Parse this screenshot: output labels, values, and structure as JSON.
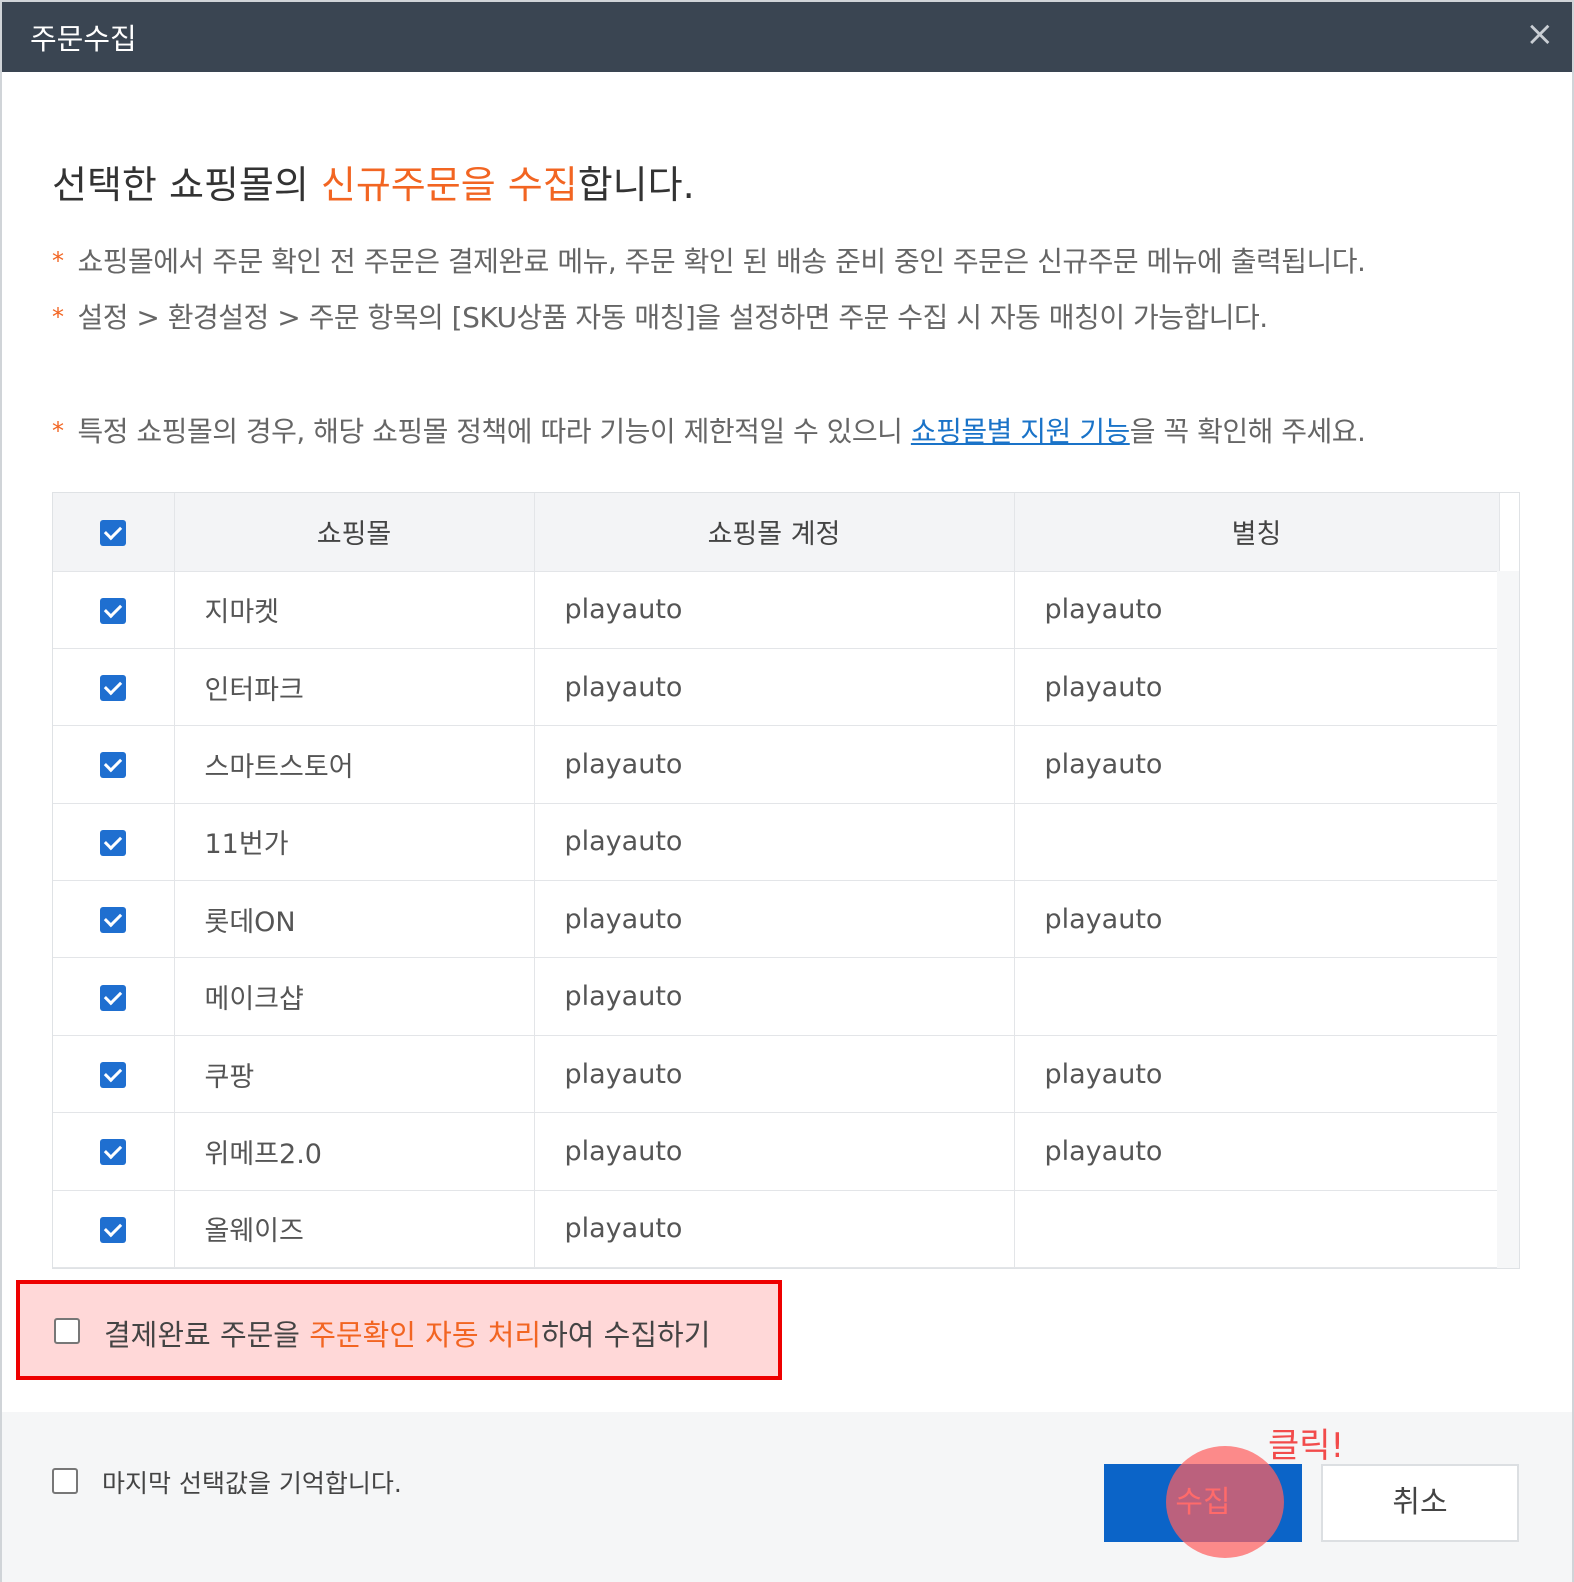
{
  "dialog": {
    "title": "주문수집",
    "close_icon": "×"
  },
  "headline": {
    "prefix": "선택한 쇼핑몰의 ",
    "highlight": "신규주문을 수집",
    "suffix": "합니다."
  },
  "notes": {
    "star": "*",
    "note1": "쇼핑몰에서 주문 확인 전 주문은 결제완료 메뉴, 주문 확인 된 배송 준비 중인 주문은 신규주문 메뉴에 출력됩니다.",
    "note2": "설정 > 환경설정 > 주문 항목의 [SKU상품 자동 매칭]을 설정하면 주문 수집 시 자동 매칭이 가능합니다.",
    "note3_prefix": "특정 쇼핑몰의 경우, 해당 쇼핑몰 정책에 따라 기능이 제한적일 수 있으니 ",
    "note3_link": "쇼핑몰별 지원 기능",
    "note3_suffix": "을 꼭 확인해 주세요."
  },
  "table": {
    "headers": {
      "mall": "쇼핑몰",
      "account": "쇼핑몰 계정",
      "alias": "별칭"
    },
    "rows": [
      {
        "mall": "지마켓",
        "account": "playauto",
        "alias": "playauto"
      },
      {
        "mall": "인터파크",
        "account": "playauto",
        "alias": "playauto"
      },
      {
        "mall": "스마트스토어",
        "account": "playauto",
        "alias": "playauto"
      },
      {
        "mall": "11번가",
        "account": "playauto",
        "alias": ""
      },
      {
        "mall": "롯데ON",
        "account": "playauto",
        "alias": "playauto"
      },
      {
        "mall": "메이크샵",
        "account": "playauto",
        "alias": ""
      },
      {
        "mall": "쿠팡",
        "account": "playauto",
        "alias": "playauto"
      },
      {
        "mall": "위메프2.0",
        "account": "playauto",
        "alias": "playauto"
      },
      {
        "mall": "올웨이즈",
        "account": "playauto",
        "alias": ""
      }
    ]
  },
  "auto_confirm": {
    "prefix": "결제완료 주문을 ",
    "highlight": "주문확인 자동 처리",
    "suffix": "하여 수집하기"
  },
  "footer": {
    "remember": "마지막 선택값을 기억합니다.",
    "collect_label": "수집",
    "cancel_label": "취소",
    "click_annotation": "클릭!"
  },
  "colors": {
    "titlebar": "#3a4552",
    "accent_orange": "#f26522",
    "link_blue": "#1a73c8",
    "primary_button": "#0b64c8",
    "highlight_border": "#ee0000",
    "highlight_fill": "#ffd8d8"
  }
}
